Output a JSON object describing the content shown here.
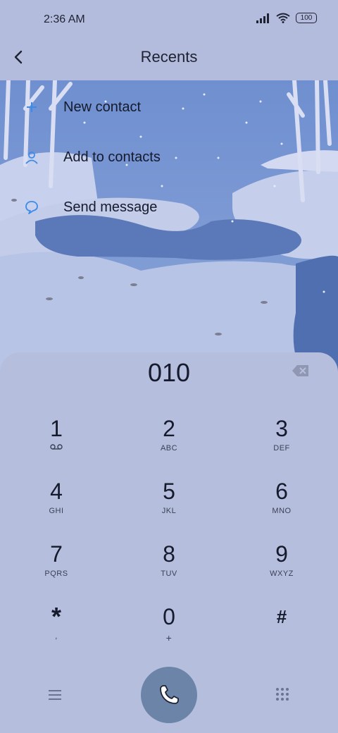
{
  "status_bar": {
    "time": "2:36 AM",
    "battery": "100",
    "icons": [
      "signal-icon",
      "wifi-icon",
      "battery-icon"
    ]
  },
  "header": {
    "title": "Recents",
    "back_icon": "back-arrow-icon"
  },
  "menu": {
    "items": [
      {
        "label": "New contact",
        "icon": "plus-icon"
      },
      {
        "label": "Add to contacts",
        "icon": "person-icon"
      },
      {
        "label": "Send message",
        "icon": "message-bubble-icon"
      }
    ]
  },
  "dialer": {
    "number": "010",
    "backspace_icon": "backspace-icon",
    "keys": [
      {
        "digit": "1",
        "letters": "",
        "icon": "voicemail-icon"
      },
      {
        "digit": "2",
        "letters": "ABC"
      },
      {
        "digit": "3",
        "letters": "DEF"
      },
      {
        "digit": "4",
        "letters": "GHI"
      },
      {
        "digit": "5",
        "letters": "JKL"
      },
      {
        "digit": "6",
        "letters": "MNO"
      },
      {
        "digit": "7",
        "letters": "PQRS"
      },
      {
        "digit": "8",
        "letters": "TUV"
      },
      {
        "digit": "9",
        "letters": "WXYZ"
      },
      {
        "digit": "*",
        "letters": ","
      },
      {
        "digit": "0",
        "letters": "+"
      },
      {
        "digit": "#",
        "letters": ""
      }
    ]
  },
  "bottom_bar": {
    "menu_icon": "hamburger-icon",
    "call_icon": "phone-icon",
    "keypad_icon": "keypad-icon"
  },
  "colors": {
    "accent_blue": "#3d8be8",
    "call_button": "#6b84a8",
    "dialer_bg": "#b5bedd"
  }
}
